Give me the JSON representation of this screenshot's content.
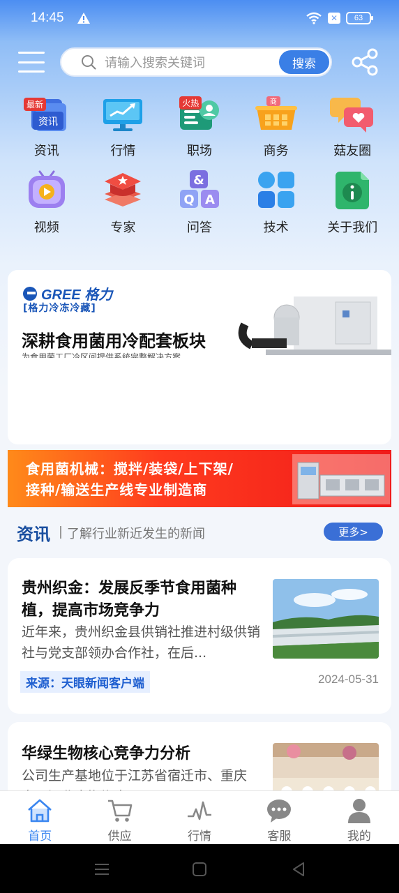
{
  "status_bar": {
    "time": "14:45",
    "battery": "63"
  },
  "search": {
    "placeholder": "请输入搜索关键词",
    "button": "搜索"
  },
  "grid": [
    {
      "label": "资讯",
      "icon": "news-icon",
      "badge": "最新"
    },
    {
      "label": "行情",
      "icon": "market-chart-icon",
      "badge": ""
    },
    {
      "label": "职场",
      "icon": "jobs-icon",
      "badge": "火热"
    },
    {
      "label": "商务",
      "icon": "shopping-basket-icon",
      "badge": ""
    },
    {
      "label": "菇友圈",
      "icon": "chat-heart-icon",
      "badge": ""
    },
    {
      "label": "视频",
      "icon": "video-play-icon",
      "badge": ""
    },
    {
      "label": "专家",
      "icon": "expert-icon",
      "badge": ""
    },
    {
      "label": "问答",
      "icon": "qa-icon",
      "badge": ""
    },
    {
      "label": "技术",
      "icon": "apps-icon",
      "badge": ""
    },
    {
      "label": "关于我们",
      "icon": "about-info-icon",
      "badge": ""
    }
  ],
  "banner1": {
    "brand": "GREE 格力",
    "brand_sub": "[格力冷冻冷藏]",
    "title": "深耕食用菌用冷配套板块",
    "subtitle": "为食用菌工厂冷区间提供系统完整解决方案"
  },
  "banner2": {
    "line1": "食用菌机械：搅拌/装袋/上下架/",
    "line2": "接种/输送生产线专业制造商"
  },
  "section": {
    "title": "资讯",
    "desc": "了解行业新近发生的新闻",
    "more": "更多>"
  },
  "news": [
    {
      "title": "贵州织金：发展反季节食用菌种植，提高市场竞争力",
      "summary": "近年来，贵州织金县供销社推进村级供销社与党支部领办合作社，在后...",
      "source": "来源：天眼新闻客户端",
      "date": "2024-05-31"
    },
    {
      "title": "华绿生物核心竞争力分析",
      "summary": "公司生产基地位于江苏省宿迁市、重庆市、河北省邯郸市..."
    }
  ],
  "tabs": [
    {
      "label": "首页",
      "icon": "home-icon"
    },
    {
      "label": "供应",
      "icon": "cart-icon"
    },
    {
      "label": "行情",
      "icon": "trend-icon"
    },
    {
      "label": "客服",
      "icon": "chat-bubble-icon"
    },
    {
      "label": "我的",
      "icon": "user-icon"
    }
  ],
  "colors": {
    "accent": "#3a86f0",
    "header_blue": "#4c8ef2",
    "badge_red": "#e53935"
  }
}
